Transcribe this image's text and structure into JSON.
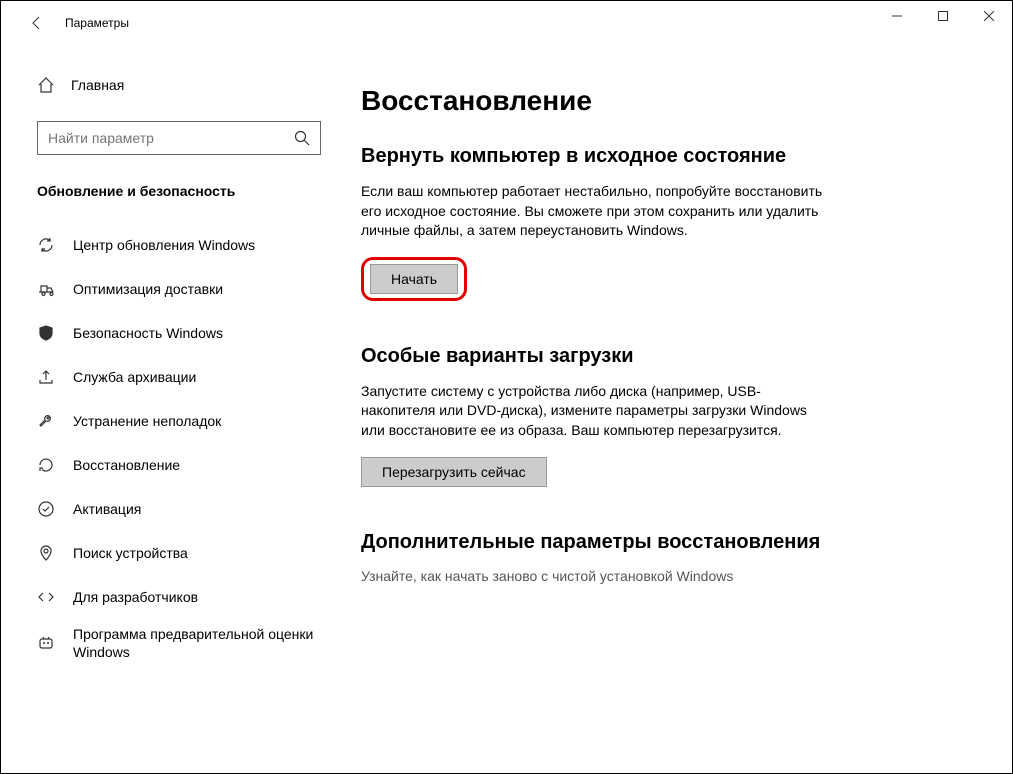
{
  "titlebar": {
    "title": "Параметры"
  },
  "sidebar": {
    "home_label": "Главная",
    "search_placeholder": "Найти параметр",
    "category": "Обновление и безопасность",
    "items": [
      {
        "label": "Центр обновления Windows"
      },
      {
        "label": "Оптимизация доставки"
      },
      {
        "label": "Безопасность Windows"
      },
      {
        "label": "Служба архивации"
      },
      {
        "label": "Устранение неполадок"
      },
      {
        "label": "Восстановление"
      },
      {
        "label": "Активация"
      },
      {
        "label": "Поиск устройства"
      },
      {
        "label": "Для разработчиков"
      },
      {
        "label": "Программа предварительной оценки Windows"
      }
    ]
  },
  "main": {
    "page_title": "Восстановление",
    "sections": [
      {
        "title": "Вернуть компьютер в исходное состояние",
        "text": "Если ваш компьютер работает нестабильно, попробуйте восстановить его исходное состояние. Вы сможете при этом сохранить или удалить личные файлы, а затем переустановить Windows.",
        "button": "Начать"
      },
      {
        "title": "Особые варианты загрузки",
        "text": "Запустите систему с устройства либо диска (например, USB-накопителя или DVD-диска), измените параметры загрузки Windows или восстановите ее из образа. Ваш компьютер перезагрузится.",
        "button": "Перезагрузить сейчас"
      },
      {
        "title": "Дополнительные параметры восстановления",
        "link": "Узнайте, как начать заново с чистой установкой Windows"
      }
    ]
  }
}
